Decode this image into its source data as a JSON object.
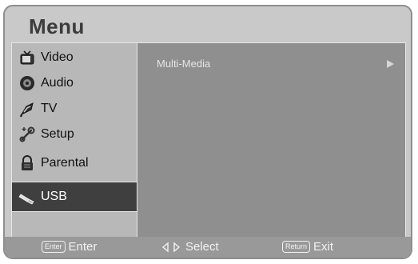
{
  "menu": {
    "title": "Menu"
  },
  "sidebar": {
    "items": [
      {
        "label": "Video",
        "icon": "video-icon"
      },
      {
        "label": "Audio",
        "icon": "audio-icon"
      },
      {
        "label": "TV",
        "icon": "tv-icon"
      },
      {
        "label": "Setup",
        "icon": "setup-icon"
      },
      {
        "label": "Parental",
        "icon": "lock-icon"
      },
      {
        "label": "USB",
        "icon": "usb-icon",
        "selected": true
      }
    ]
  },
  "content": {
    "items": [
      {
        "label": "Multi-Media",
        "icon": "arrow-right-icon"
      }
    ]
  },
  "footer": {
    "enter_key": "Enter",
    "enter_label": "Enter",
    "select_label": "Select",
    "return_key": "Return",
    "exit_label": "Exit"
  },
  "colors": {
    "frame": "#c9c9c9",
    "panel": "#b8b8b8",
    "content_bg": "#8f8f8f",
    "selected_bg": "#3f3f3f",
    "footer_bg": "#999999"
  }
}
